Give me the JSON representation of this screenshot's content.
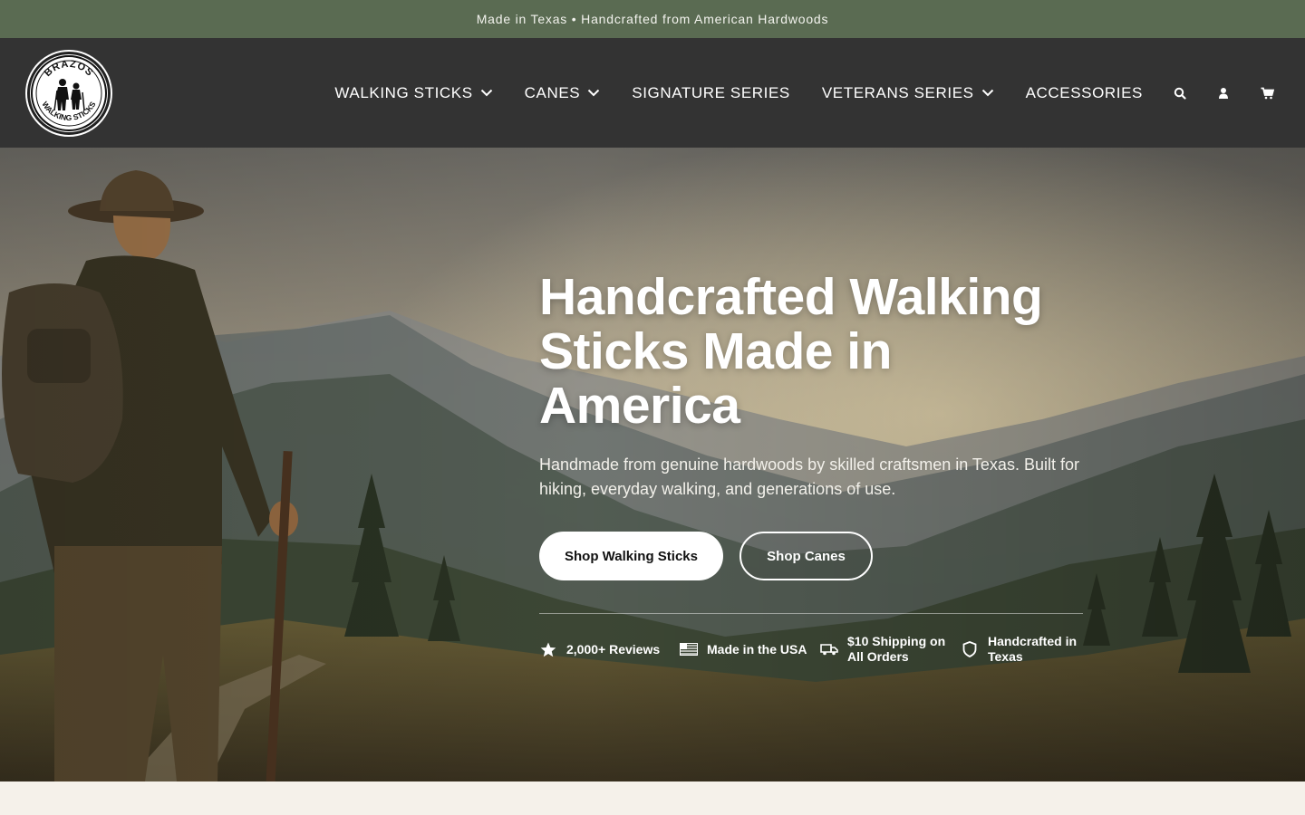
{
  "announcement": "Made in Texas • Handcrafted from American Hardwoods",
  "brand": {
    "logo_top_text": "BRAZOS",
    "logo_bottom_text": "WALKING STICKS"
  },
  "nav": {
    "items": [
      {
        "label": "WALKING STICKS",
        "has_dropdown": true
      },
      {
        "label": "CANES",
        "has_dropdown": true
      },
      {
        "label": "SIGNATURE SERIES",
        "has_dropdown": false
      },
      {
        "label": "VETERANS SERIES",
        "has_dropdown": true
      },
      {
        "label": "ACCESSORIES",
        "has_dropdown": false
      }
    ],
    "icons": [
      "search-icon",
      "account-icon",
      "cart-icon"
    ]
  },
  "hero": {
    "title": "Handcrafted Walking Sticks Made in America",
    "subtitle": "Handmade from genuine hardwoods by skilled craftsmen in Texas. Built for hiking, everyday walking, and generations of use.",
    "primary_cta": "Shop Walking Sticks",
    "secondary_cta": "Shop Canes",
    "badges": [
      {
        "icon": "star-icon",
        "label": "2,000+ Reviews"
      },
      {
        "icon": "flag-icon",
        "label": "Made in the USA"
      },
      {
        "icon": "truck-icon",
        "label": "$10 Shipping on All Orders"
      },
      {
        "icon": "shield-icon",
        "label": "Handcrafted in Texas"
      }
    ]
  },
  "colors": {
    "announcement_bg": "#5a6b52",
    "header_bg": "#333333",
    "page_bg": "#f5f1ea"
  }
}
